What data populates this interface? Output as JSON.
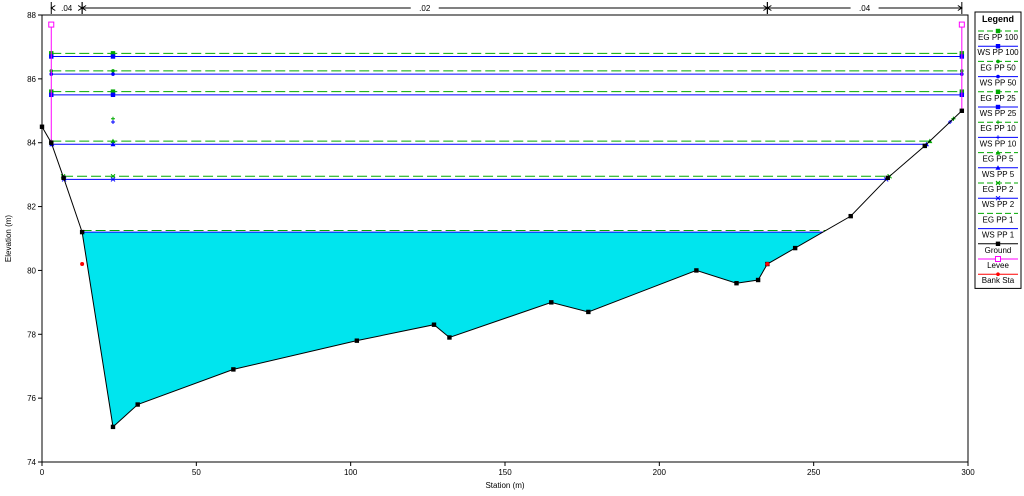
{
  "chart_data": {
    "type": "line",
    "xlabel": "Station (m)",
    "ylabel": "Elevation (m)",
    "xlim": [
      0,
      300
    ],
    "ylim": [
      74,
      88
    ],
    "x_ticks": [
      "0",
      "50",
      "100",
      "150",
      "200",
      "250",
      "300"
    ],
    "y_ticks": [
      "74",
      "76",
      "78",
      "80",
      "82",
      "84",
      "86",
      "88"
    ],
    "manning_n": [
      {
        "label": ".04",
        "from": 3,
        "to": 13
      },
      {
        "label": ".02",
        "from": 13,
        "to": 235
      },
      {
        "label": ".04",
        "from": 235,
        "to": 298
      }
    ],
    "legend": {
      "title": "Legend",
      "items": [
        {
          "label": "EG PP 100",
          "color": "#00aa00",
          "dash": true,
          "marker": "square"
        },
        {
          "label": "WS PP 100",
          "color": "#0000ff",
          "dash": false,
          "marker": "square"
        },
        {
          "label": "EG PP 50",
          "color": "#00aa00",
          "dash": true,
          "marker": "dot"
        },
        {
          "label": "WS PP 50",
          "color": "#0000ff",
          "dash": false,
          "marker": "dot"
        },
        {
          "label": "EG PP 25",
          "color": "#00aa00",
          "dash": true,
          "marker": "square"
        },
        {
          "label": "WS PP 25",
          "color": "#0000ff",
          "dash": false,
          "marker": "square"
        },
        {
          "label": "EG PP 10",
          "color": "#00aa00",
          "dash": true,
          "marker": "plus"
        },
        {
          "label": "WS PP 10",
          "color": "#0000ff",
          "dash": false,
          "marker": "plus"
        },
        {
          "label": "EG PP 5",
          "color": "#00aa00",
          "dash": true,
          "marker": "triangle"
        },
        {
          "label": "WS PP 5",
          "color": "#0000ff",
          "dash": false,
          "marker": "triangle"
        },
        {
          "label": "EG PP 2",
          "color": "#00aa00",
          "dash": true,
          "marker": "x"
        },
        {
          "label": "WS PP 2",
          "color": "#0000ff",
          "dash": false,
          "marker": "x"
        },
        {
          "label": "EG PP 1",
          "color": "#00aa00",
          "dash": true,
          "marker": "none"
        },
        {
          "label": "WS PP 1",
          "color": "#0000ff",
          "dash": false,
          "marker": "none"
        },
        {
          "label": "Ground",
          "color": "#000000",
          "dash": false,
          "marker": "square"
        },
        {
          "label": "Levee",
          "color": "#ff00ff",
          "dash": false,
          "marker": "open-square"
        },
        {
          "label": "Bank Sta",
          "color": "#ff0000",
          "dash": false,
          "marker": "dot"
        }
      ]
    },
    "ground": [
      [
        0,
        84.5
      ],
      [
        3,
        84.0
      ],
      [
        7,
        82.9
      ],
      [
        13,
        81.2
      ],
      [
        23,
        75.1
      ],
      [
        31,
        75.8
      ],
      [
        62,
        76.9
      ],
      [
        102,
        77.8
      ],
      [
        127,
        78.3
      ],
      [
        132,
        77.9
      ],
      [
        165,
        79.0
      ],
      [
        177,
        78.7
      ],
      [
        212,
        80.0
      ],
      [
        225,
        79.6
      ],
      [
        232,
        79.7
      ],
      [
        235,
        80.2
      ],
      [
        244,
        80.7
      ],
      [
        262,
        81.7
      ],
      [
        274,
        82.9
      ],
      [
        286,
        83.9
      ],
      [
        298,
        85.0
      ]
    ],
    "bank_stations": [
      [
        13,
        80.2
      ],
      [
        235,
        80.2
      ]
    ],
    "levees": [
      {
        "x": 3,
        "y": 87.7
      },
      {
        "x": 298,
        "y": 87.7
      }
    ],
    "ws_fill": {
      "elevation": 81.2,
      "color": "#00e5ee"
    },
    "profiles": [
      {
        "name": "EG PP 100",
        "elevation": 86.8,
        "kind": "EG"
      },
      {
        "name": "WS PP 100",
        "elevation": 86.7,
        "kind": "WS"
      },
      {
        "name": "EG PP 50",
        "elevation": 86.25,
        "kind": "EG"
      },
      {
        "name": "WS PP 50",
        "elevation": 86.15,
        "kind": "WS"
      },
      {
        "name": "EG PP 25",
        "elevation": 85.6,
        "kind": "EG"
      },
      {
        "name": "WS PP 25",
        "elevation": 85.5,
        "kind": "WS"
      },
      {
        "name": "EG PP 10",
        "elevation": 84.75,
        "kind": "EG"
      },
      {
        "name": "WS PP 10",
        "elevation": 84.65,
        "kind": "WS"
      },
      {
        "name": "EG PP 5",
        "elevation": 84.05,
        "kind": "EG"
      },
      {
        "name": "WS PP 5",
        "elevation": 83.95,
        "kind": "WS"
      },
      {
        "name": "EG PP 2",
        "elevation": 82.95,
        "kind": "EG"
      },
      {
        "name": "WS PP 2",
        "elevation": 82.85,
        "kind": "WS"
      },
      {
        "name": "EG PP 1",
        "elevation": 81.25,
        "kind": "EG"
      },
      {
        "name": "WS PP 1",
        "elevation": 81.2,
        "kind": "WS"
      }
    ]
  }
}
